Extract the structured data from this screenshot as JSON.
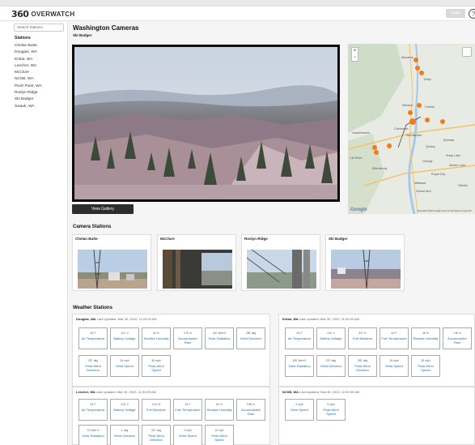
{
  "header": {
    "logo_mark": "360",
    "logo_text": "OVERWATCH",
    "login_label": "Login",
    "help_glyph": "?"
  },
  "sidebar": {
    "search_placeholder": "Search Stations",
    "title": "Stations",
    "items": [
      "Chelan Butte",
      "Douglas, WA",
      "Entiat, WA",
      "Leecher, WA",
      "McClure",
      "NCSB, WA",
      "Peoh Point, WA",
      "Roslyn Ridge",
      "Ski Badger",
      "Swauk, WA"
    ]
  },
  "main": {
    "title": "Washington Cameras",
    "subtitle": "Ski Badger",
    "gallery_label": "View Gallery",
    "camera_stations_title": "Camera Stations",
    "weather_stations_title": "Weather Stations"
  },
  "map": {
    "zoom_in": "+",
    "zoom_out": "−",
    "google": "Google",
    "attribution": "Map data ©2022 Google   Terms of Use   Report a map error",
    "places": [
      "Mazama",
      "Twisp",
      "Manson",
      "Chelan",
      "Cashmere",
      "Wenatchee",
      "Cle Elum",
      "Ellensburg",
      "Quincy",
      "Ephrata",
      "Soap Lake",
      "George",
      "Royal City",
      "Moses Lake",
      "Othello",
      "Mattawa",
      "Desert Aire",
      "Leavenworth"
    ],
    "colors": {
      "marker": "#f07d1a",
      "road": "#f3c36b",
      "water": "#a8c8e8"
    }
  },
  "camera_cards": [
    {
      "title": "Chelan Butte"
    },
    {
      "title": "McClure"
    },
    {
      "title": "Roslyn Ridge"
    },
    {
      "title": "Ski Badger"
    }
  ],
  "weather": [
    {
      "name": "Douglas, WA",
      "updated": "Last Updated: Mar 30, 2022, 11:00:00 AM",
      "tiles": [
        {
          "value": "45",
          "unit": "F",
          "label": "Air Temperature"
        },
        {
          "value": "14.2",
          "unit": "V",
          "label": "Battery Voltage"
        },
        {
          "value": "44",
          "unit": "%",
          "label": "Relative Humidity"
        },
        {
          "value": "0.75",
          "unit": "in",
          "label": "Accumulative Rain"
        },
        {
          "value": "132",
          "unit": "W/m^2",
          "label": "Solar Radiation"
        },
        {
          "value": "296",
          "unit": "deg",
          "label": "Wind Direction"
        },
        {
          "value": "297",
          "unit": "deg",
          "label": "Peak Wind Direction"
        },
        {
          "value": "26",
          "unit": "mph",
          "label": "Wind Speed"
        },
        {
          "value": "38",
          "unit": "mph",
          "label": "Peak Wind Speed"
        }
      ]
    },
    {
      "name": "Entiat, WA",
      "updated": "Last Updated: Mar 30, 2022, 11:00:00 AM",
      "tiles": [
        {
          "value": "44",
          "unit": "F",
          "label": "Air Temperature"
        },
        {
          "value": "14.0",
          "unit": "V",
          "label": "Battery Voltage"
        },
        {
          "value": "8.9",
          "unit": "%",
          "label": "Fuel Moisture"
        },
        {
          "value": "44",
          "unit": "F",
          "label": "Fuel Temperature"
        },
        {
          "value": "46",
          "unit": "%",
          "label": "Relative Humidity"
        },
        {
          "value": "1.90",
          "unit": "in",
          "label": "Accumulative Rain"
        },
        {
          "value": "159",
          "unit": "W/m^2",
          "label": "Solar Radiation"
        },
        {
          "value": "270",
          "unit": "deg",
          "label": "Wind Direction"
        },
        {
          "value": "282",
          "unit": "deg",
          "label": "Peak Wind Direction"
        },
        {
          "value": "16",
          "unit": "mph",
          "label": "Wind Speed"
        },
        {
          "value": "35",
          "unit": "mph",
          "label": "Peak Wind Speed"
        }
      ]
    },
    {
      "name": "Leecher, WA",
      "updated": "Last Updated: Mar 30, 2022, 11:00:00 AM",
      "tiles": [
        {
          "value": "33",
          "unit": "F",
          "label": "Air Temperature"
        },
        {
          "value": "13.5",
          "unit": "V",
          "label": "Battery Voltage"
        },
        {
          "value": "11.8",
          "unit": "%",
          "label": "Fuel Moisture"
        },
        {
          "value": "34",
          "unit": "F",
          "label": "Fuel Temperature"
        },
        {
          "value": "60",
          "unit": "%",
          "label": "Relative Humidity"
        },
        {
          "value": "0.59",
          "unit": "in",
          "label": "Accumulative Rain"
        },
        {
          "value": "73",
          "unit": "W/m^2",
          "label": "Solar Radiation"
        },
        {
          "value": "1",
          "unit": "deg",
          "label": "Wind Direction"
        },
        {
          "value": "327",
          "unit": "deg",
          "label": "Peak Wind Direction"
        },
        {
          "value": "2",
          "unit": "mph",
          "label": "Wind Speed"
        },
        {
          "value": "10",
          "unit": "mph",
          "label": "Peak Wind Speed"
        }
      ]
    },
    {
      "name": "NCSB, WA",
      "updated": "Last Updated: Mar 30, 2022, 11:00:00 AM",
      "tiles": [
        {
          "value": "2",
          "unit": "mph",
          "label": "Wind Speed"
        },
        {
          "value": "9",
          "unit": "mph",
          "label": "Peak Wind Speed"
        }
      ]
    }
  ]
}
